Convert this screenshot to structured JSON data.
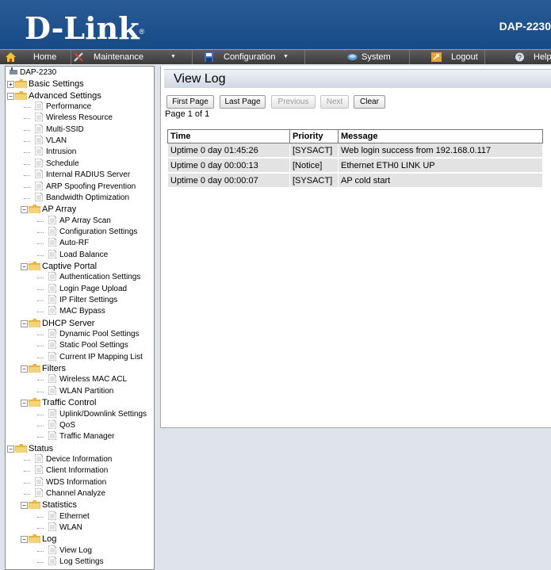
{
  "header": {
    "brand": "D-Link",
    "brand_mark": "®",
    "model": "DAP-2230"
  },
  "menu": [
    {
      "label": "Home",
      "icon": "home-icon"
    },
    {
      "label": "Maintenance",
      "icon": "tools-icon",
      "caret": "▼"
    },
    {
      "label": "Configuration",
      "icon": "floppy-icon",
      "caret": "▼"
    },
    {
      "label": "System",
      "icon": "system-icon"
    },
    {
      "label": "Logout",
      "icon": "logout-icon"
    },
    {
      "label": "Help",
      "icon": "help-icon"
    }
  ],
  "tree": {
    "root": "DAP-2230",
    "items": [
      {
        "label": "Basic Settings",
        "type": "folder",
        "expander": "+"
      },
      {
        "label": "Advanced Settings",
        "type": "folder",
        "expander": "−"
      },
      {
        "label": "Performance",
        "type": "doc"
      },
      {
        "label": "Wireless Resource",
        "type": "doc"
      },
      {
        "label": "Multi-SSID",
        "type": "doc"
      },
      {
        "label": "VLAN",
        "type": "doc"
      },
      {
        "label": "Intrusion",
        "type": "doc"
      },
      {
        "label": "Schedule",
        "type": "doc"
      },
      {
        "label": "Internal RADIUS Server",
        "type": "doc"
      },
      {
        "label": "ARP Spoofing Prevention",
        "type": "doc"
      },
      {
        "label": "Bandwidth Optimization",
        "type": "doc"
      },
      {
        "label": "AP Array",
        "type": "folder",
        "expander": "−"
      },
      {
        "label": "AP Array Scan",
        "type": "doc"
      },
      {
        "label": "Configuration Settings",
        "type": "doc"
      },
      {
        "label": "Auto-RF",
        "type": "doc"
      },
      {
        "label": "Load Balance",
        "type": "doc"
      },
      {
        "label": "Captive Portal",
        "type": "folder",
        "expander": "−"
      },
      {
        "label": "Authentication Settings",
        "type": "doc"
      },
      {
        "label": "Login Page Upload",
        "type": "doc"
      },
      {
        "label": "IP Filter Settings",
        "type": "doc"
      },
      {
        "label": "MAC Bypass",
        "type": "doc"
      },
      {
        "label": "DHCP Server",
        "type": "folder",
        "expander": "−"
      },
      {
        "label": "Dynamic Pool Settings",
        "type": "doc"
      },
      {
        "label": "Static Pool Settings",
        "type": "doc"
      },
      {
        "label": "Current IP Mapping List",
        "type": "doc"
      },
      {
        "label": "Filters",
        "type": "folder",
        "expander": "−"
      },
      {
        "label": "Wireless MAC ACL",
        "type": "doc"
      },
      {
        "label": "WLAN Partition",
        "type": "doc"
      },
      {
        "label": "Traffic Control",
        "type": "folder",
        "expander": "−"
      },
      {
        "label": "Uplink/Downlink Settings",
        "type": "doc"
      },
      {
        "label": "QoS",
        "type": "doc"
      },
      {
        "label": "Traffic Manager",
        "type": "doc"
      },
      {
        "label": "Status",
        "type": "folder",
        "expander": "−"
      },
      {
        "label": "Device Information",
        "type": "doc"
      },
      {
        "label": "Client Information",
        "type": "doc"
      },
      {
        "label": "WDS Information",
        "type": "doc"
      },
      {
        "label": "Channel Analyze",
        "type": "doc"
      },
      {
        "label": "Statistics",
        "type": "folder",
        "expander": "−"
      },
      {
        "label": "Ethernet",
        "type": "doc"
      },
      {
        "label": "WLAN",
        "type": "doc"
      },
      {
        "label": "Log",
        "type": "folder",
        "expander": "−"
      },
      {
        "label": "View Log",
        "type": "doc"
      },
      {
        "label": "Log Settings",
        "type": "doc"
      }
    ]
  },
  "main": {
    "title": "View Log",
    "buttons": {
      "first": "First Page",
      "last": "Last Page",
      "previous": "Previous",
      "next": "Next",
      "clear": "Clear"
    },
    "page_info": "Page 1 of 1",
    "table": {
      "headers": [
        "Time",
        "Priority",
        "Message"
      ],
      "rows": [
        [
          "Uptime 0 day 01:45:26",
          "[SYSACT]",
          "Web login success from 192.168.0.117"
        ],
        [
          "Uptime 0 day 00:00:13",
          "[Notice]",
          "Ethernet ETH0 LINK UP"
        ],
        [
          "Uptime 0 day 00:00:07",
          "[SYSACT]",
          "AP cold start"
        ]
      ]
    }
  },
  "colors": {
    "header_blue": "#1f4f8c",
    "menubar": "#4a4a4a",
    "folder": "#e8b640",
    "row_bg": "#e3e3e3"
  }
}
